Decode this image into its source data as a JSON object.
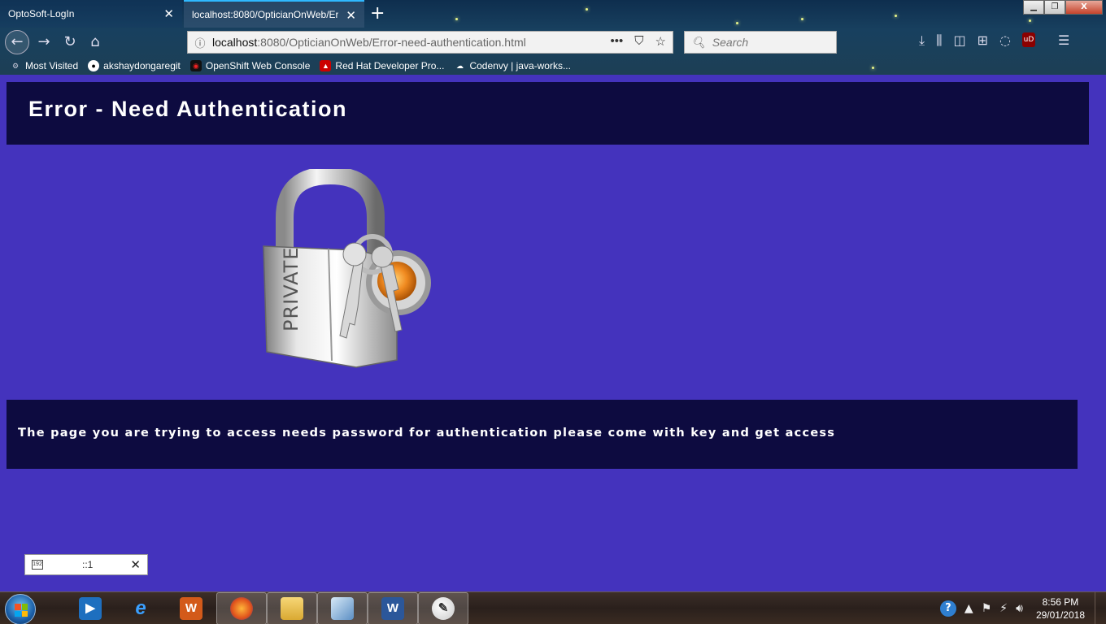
{
  "browser": {
    "tabs": [
      {
        "label": "OptoSoft-LogIn",
        "active": false
      },
      {
        "label": "localhost:8080/OpticianOnWeb/Err",
        "active": true
      }
    ],
    "window_controls": {
      "minimize": "▁",
      "restore": "❐",
      "close": "X"
    },
    "url": {
      "host": "localhost",
      "path": ":8080/OpticianOnWeb/Error-need-authentication.html"
    },
    "search_placeholder": "Search",
    "bookmarks": [
      {
        "label": "Most Visited",
        "icon": "gear-icon"
      },
      {
        "label": "akshaydongaregit",
        "icon": "github-icon"
      },
      {
        "label": "OpenShift Web Console",
        "icon": "openshift-icon"
      },
      {
        "label": "Red Hat Developer Pro...",
        "icon": "redhat-icon"
      },
      {
        "label": "Codenvy | java-works...",
        "icon": "cloud-icon"
      }
    ],
    "ublock_label": "uD"
  },
  "page": {
    "title": "Error - Need Authentication",
    "message": "The page you are trying to access needs password for authentication please come with key and get access",
    "lock_label": "PRIVATE"
  },
  "ime_popup": {
    "text": "::1",
    "icon_text": "192"
  },
  "taskbar": {
    "word_label": "W",
    "clock": {
      "time": "8:56 PM",
      "date": "29/01/2018"
    }
  },
  "colors": {
    "page_background": "#4433bd",
    "bar_background": "#0d0b40",
    "text": "#ffffff"
  }
}
